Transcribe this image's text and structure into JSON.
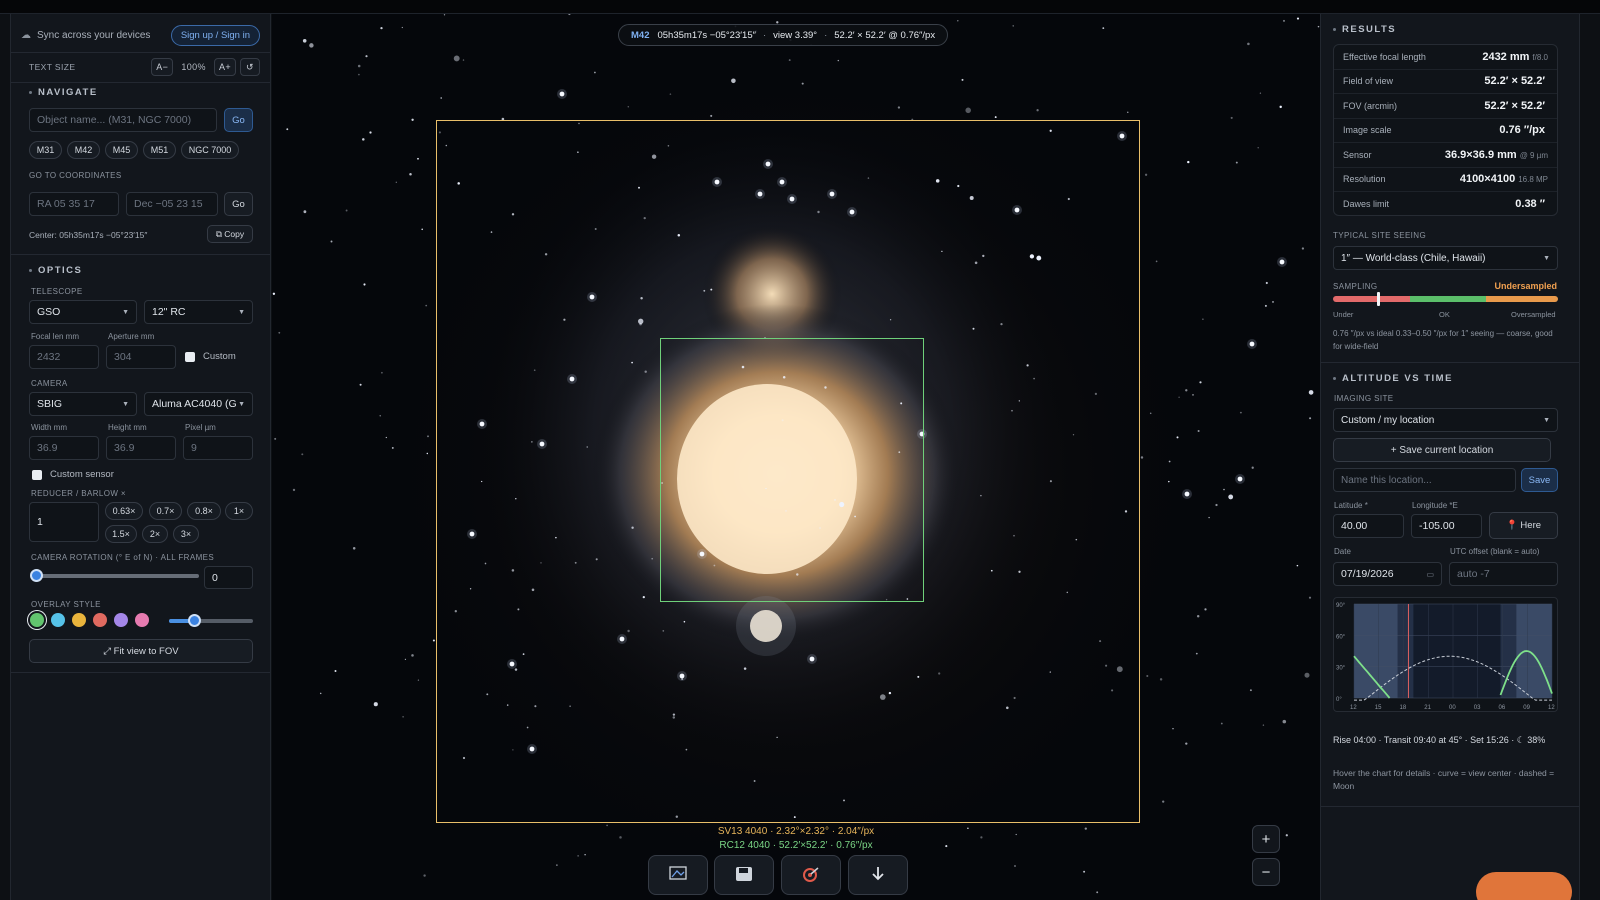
{
  "sidebar": {
    "sync_text": "Sync across your devices",
    "signin_label": "Sign up / Sign in",
    "textsize_label": "TEXT SIZE",
    "textsize_minus": "A−",
    "textsize_value": "100%",
    "textsize_plus": "A+",
    "textsize_reset": "↺",
    "navigate": {
      "title": "NAVIGATE",
      "object_placeholder": "Object name... (M31, NGC 7000)",
      "go_label": "Go",
      "quick_targets": [
        "M31",
        "M42",
        "M45",
        "M51",
        "NGC 7000"
      ],
      "coords_label": "GO TO COORDINATES",
      "ra_placeholder": "RA  05 35 17",
      "dec_placeholder": "Dec  −05 23 15",
      "coords_go": "Go",
      "center_text": "Center: 05h35m17s −05°23′15″",
      "copy_label": "⧉ Copy"
    },
    "optics": {
      "title": "OPTICS",
      "telescope_label": "TELESCOPE",
      "telescope_brand": "GSO",
      "telescope_model": "12\" RC",
      "focal_label": "Focal len mm",
      "focal_value": "2432",
      "aperture_label": "Aperture mm",
      "aperture_value": "304",
      "custom_label": "Custom",
      "camera_label": "CAMERA",
      "camera_brand": "SBIG",
      "camera_model": "Aluma AC4040 (G",
      "width_label": "Width mm",
      "width_value": "36.9",
      "height_label": "Height mm",
      "height_value": "36.9",
      "pixel_label": "Pixel µm",
      "pixel_value": "9",
      "custom_sensor_label": "Custom sensor",
      "reducer_label": "REDUCER / BARLOW ×",
      "reducer_value": "1",
      "reducer_presets": [
        "0.63×",
        "0.7×",
        "0.8×",
        "1×",
        "1.5×",
        "2×",
        "3×"
      ],
      "rotation_label": "CAMERA ROTATION (° E of N) · ALL FRAMES",
      "rotation_value": "0",
      "rotation_fraction": 0.0,
      "overlay_label": "OVERLAY STYLE",
      "overlay_colors": [
        "#62c46e",
        "#56c2e8",
        "#e9b43c",
        "#e06a60",
        "#a487e8",
        "#e67bb0"
      ],
      "overlay_opacity_fraction": 0.3,
      "fit_label": "⤢ Fit view to FOV"
    }
  },
  "viewport": {
    "object": "M42",
    "coords": "05h35m17s −05°23′15″",
    "view": "view 3.39°",
    "fov": "52.2′ × 52.2′ @ 0.76″/px",
    "legend_orange": "SV13 4040 · 2.32°×2.32° · 2.04″/px",
    "legend_green": "RC12 4040 · 52.2′×52.2′ · 0.76″/px",
    "tools": [
      "image-icon",
      "save-icon",
      "target-icon",
      "download-icon"
    ],
    "zoom_in": "+",
    "zoom_out": "−"
  },
  "results": {
    "title": "RESULTS",
    "rows": [
      {
        "label": "Effective focal length",
        "value": "2432 mm",
        "unit": "f/8.0"
      },
      {
        "label": "Field of view",
        "value": "52.2′ × 52.2′",
        "unit": ""
      },
      {
        "label": "FOV (arcmin)",
        "value": "52.2′ × 52.2′",
        "unit": ""
      },
      {
        "label": "Image scale",
        "value": "0.76 ″/px",
        "unit": ""
      },
      {
        "label": "Sensor",
        "value": "36.9×36.9 mm",
        "unit": "@ 9 µm"
      },
      {
        "label": "Resolution",
        "value": "4100×4100",
        "unit": "16.8 MP"
      },
      {
        "label": "Dawes limit",
        "value": "0.38 ″",
        "unit": ""
      }
    ],
    "seeing_label": "TYPICAL SITE SEEING",
    "seeing_value": "1″ — World-class (Chile, Hawaii)",
    "sampling_label": "SAMPLING",
    "sampling_status": "Undersampled",
    "sampling_under": "Under",
    "sampling_ok": "OK",
    "sampling_over": "Oversampled",
    "sampling_fraction": 0.2,
    "sampling_note": "0.76 ″/px vs ideal 0.33–0.50 ″/px for 1″ seeing — coarse, good for wide-field"
  },
  "altitude": {
    "title": "ALTITUDE VS TIME",
    "site_label": "IMAGING SITE",
    "site_value": "Custom / my location",
    "save_current": "+ Save current location",
    "name_placeholder": "Name this location...",
    "save_label": "Save",
    "lat_label": "Latitude *",
    "lat_value": "40.00",
    "lon_label": "Longitude *E",
    "lon_value": "-105.00",
    "here_label": "📍 Here",
    "date_label": "Date",
    "date_value": "07/19/2026",
    "utc_label": "UTC offset (blank = auto)",
    "utc_placeholder": "auto -7",
    "y_ticks": [
      "90°",
      "60°",
      "30°",
      "0°"
    ],
    "x_ticks": [
      "12",
      "15",
      "18",
      "21",
      "00",
      "03",
      "06",
      "09",
      "12"
    ],
    "summary": "Rise 04:00 · Transit 09:40 at 45° · Set 15:26 · ☾ 38%",
    "hint": "Hover the chart for details · curve = view center · dashed = Moon"
  },
  "colors": {
    "accent": "#4a90e2",
    "fov_outer": "#e9bf6a",
    "fov_inner": "#6fd07a",
    "undersampled": "#f0a050"
  }
}
